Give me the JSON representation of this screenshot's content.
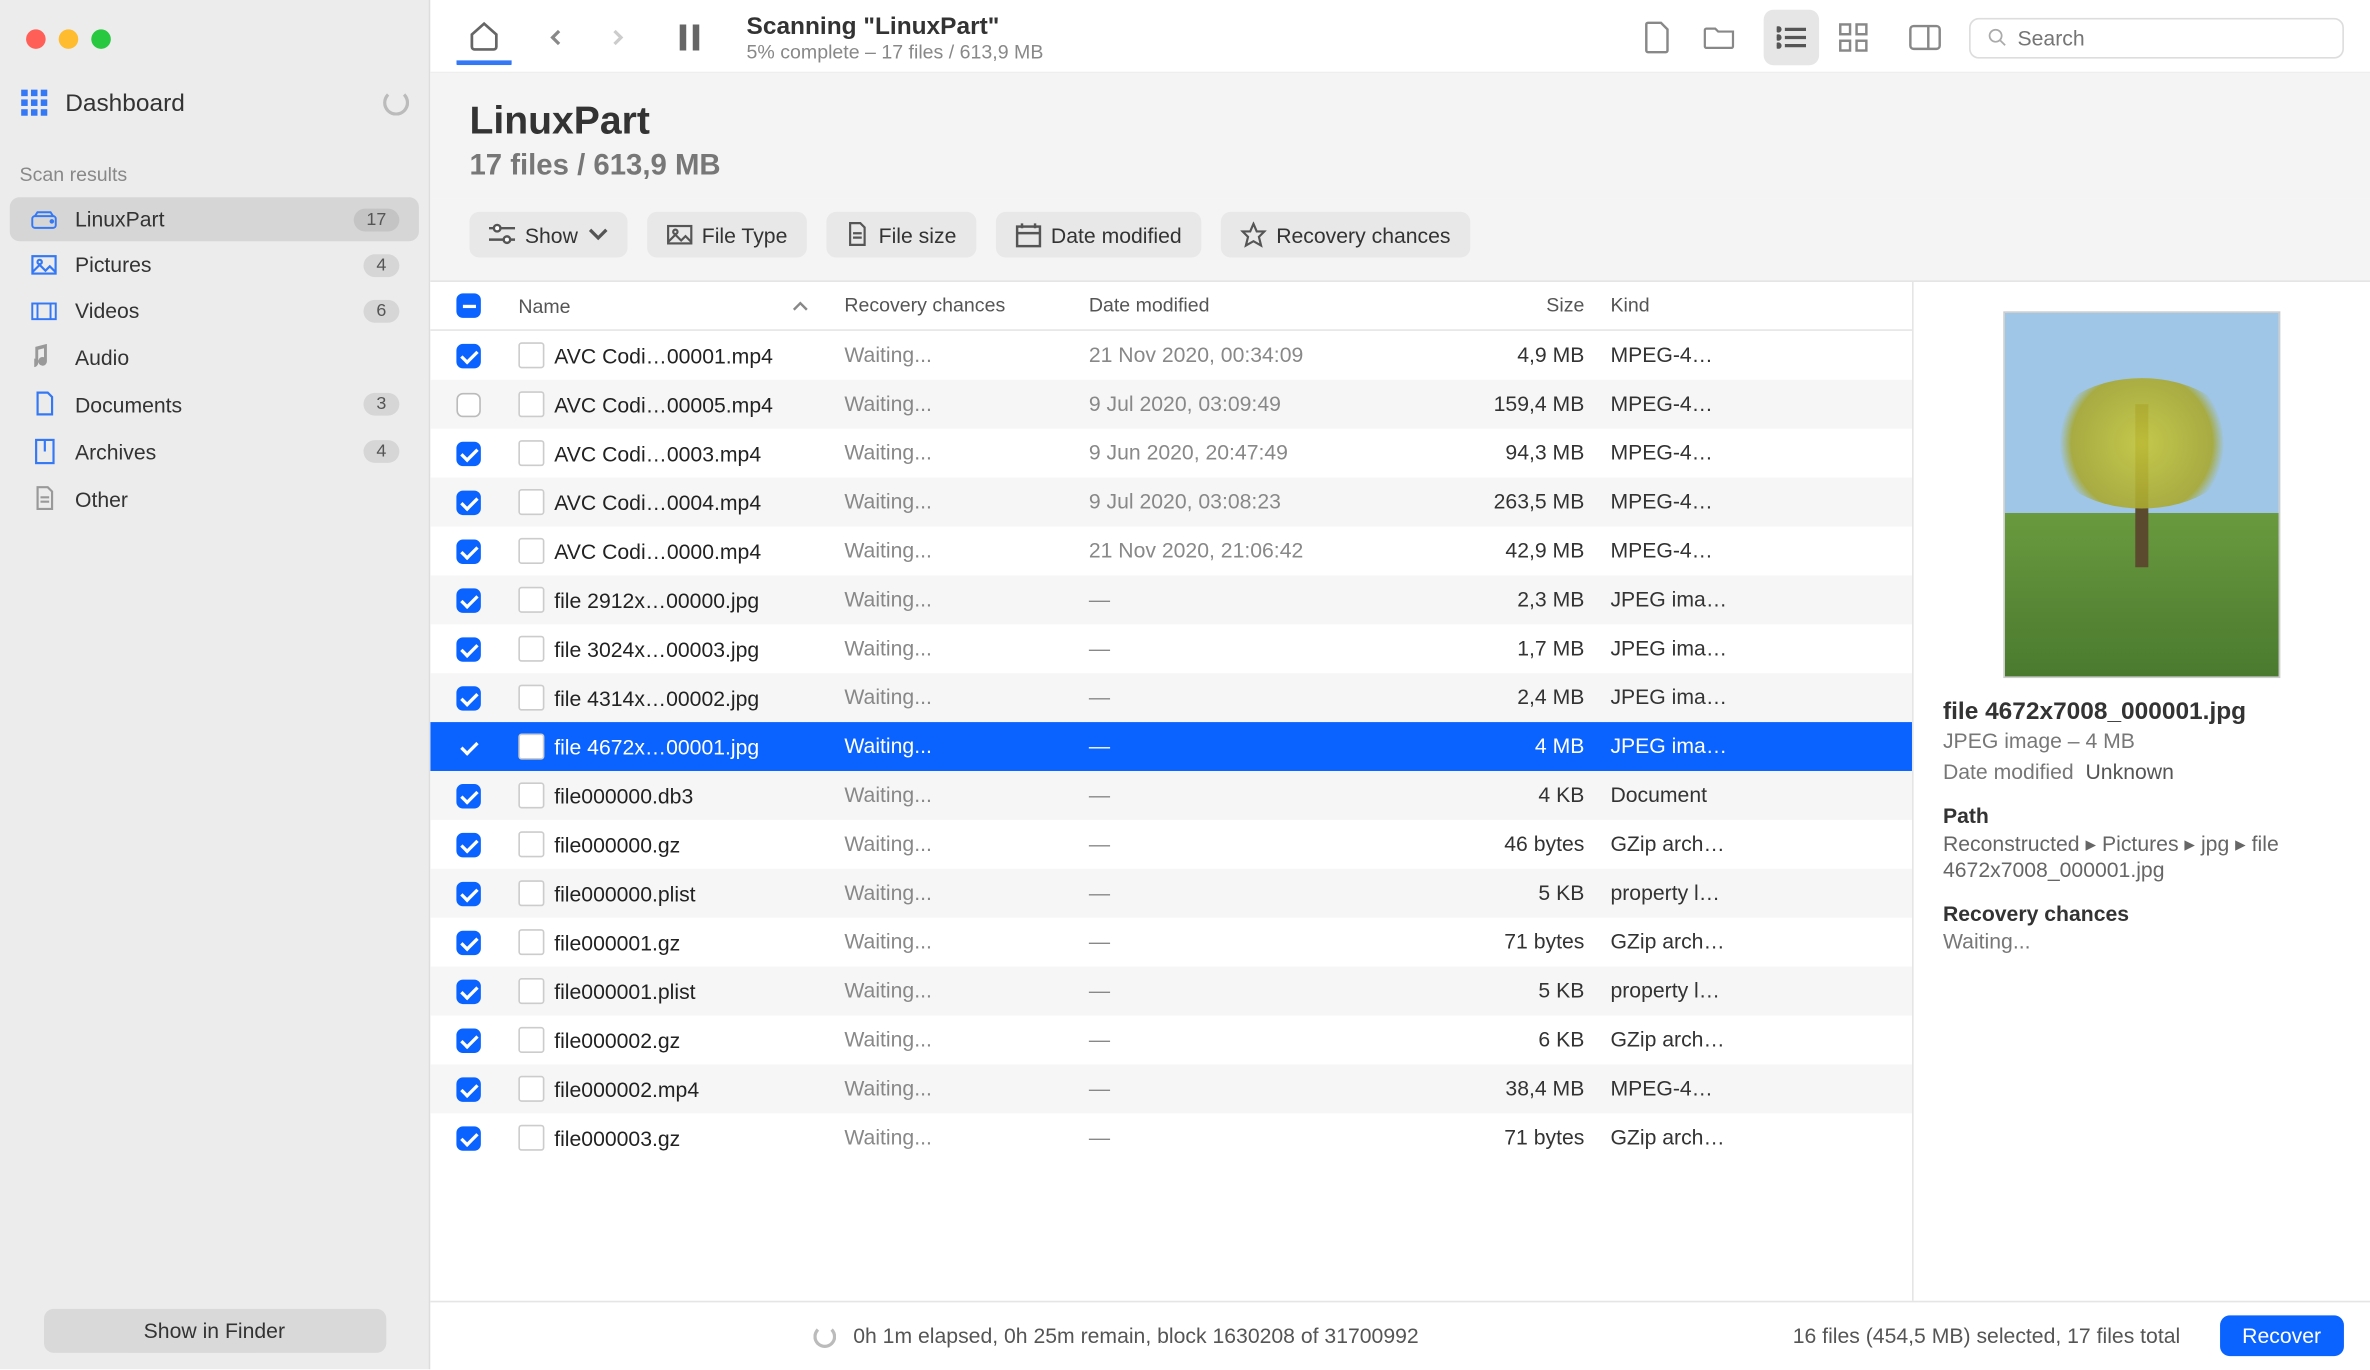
{
  "sidebar": {
    "dashboard": "Dashboard",
    "section": "Scan results",
    "items": [
      {
        "icon": "drive",
        "label": "LinuxPart",
        "badge": "17",
        "selected": true
      },
      {
        "icon": "image",
        "label": "Pictures",
        "badge": "4"
      },
      {
        "icon": "video",
        "label": "Videos",
        "badge": "6"
      },
      {
        "icon": "audio",
        "label": "Audio",
        "muted": true
      },
      {
        "icon": "doc",
        "label": "Documents",
        "badge": "3"
      },
      {
        "icon": "archive",
        "label": "Archives",
        "badge": "4"
      },
      {
        "icon": "other",
        "label": "Other",
        "muted": true
      }
    ],
    "finder_btn": "Show in Finder"
  },
  "toolbar": {
    "title": "Scanning \"LinuxPart\"",
    "subtitle": "5% complete – 17 files / 613,9 MB",
    "search_placeholder": "Search"
  },
  "header": {
    "title": "LinuxPart",
    "subtitle": "17 files / 613,9 MB"
  },
  "filters": {
    "show": "Show",
    "file_type": "File Type",
    "file_size": "File size",
    "date_modified": "Date modified",
    "recovery_chances": "Recovery chances"
  },
  "columns": {
    "name": "Name",
    "recovery": "Recovery chances",
    "date": "Date modified",
    "size": "Size",
    "kind": "Kind"
  },
  "rows": [
    {
      "checked": true,
      "name": "AVC Codi…00001.mp4",
      "recovery": "Waiting...",
      "date": "21 Nov 2020, 00:34:09",
      "size": "4,9 MB",
      "kind": "MPEG-4…"
    },
    {
      "checked": false,
      "name": "AVC Codi…00005.mp4",
      "recovery": "Waiting...",
      "date": "9 Jul 2020, 03:09:49",
      "size": "159,4 MB",
      "kind": "MPEG-4…"
    },
    {
      "checked": true,
      "name": "AVC Codi…0003.mp4",
      "recovery": "Waiting...",
      "date": "9 Jun 2020, 20:47:49",
      "size": "94,3 MB",
      "kind": "MPEG-4…"
    },
    {
      "checked": true,
      "name": "AVC Codi…0004.mp4",
      "recovery": "Waiting...",
      "date": "9 Jul 2020, 03:08:23",
      "size": "263,5 MB",
      "kind": "MPEG-4…"
    },
    {
      "checked": true,
      "name": "AVC Codi…0000.mp4",
      "recovery": "Waiting...",
      "date": "21 Nov 2020, 21:06:42",
      "size": "42,9 MB",
      "kind": "MPEG-4…"
    },
    {
      "checked": true,
      "name": "file 2912x…00000.jpg",
      "recovery": "Waiting...",
      "date": "—",
      "size": "2,3 MB",
      "kind": "JPEG ima…"
    },
    {
      "checked": true,
      "name": "file 3024x…00003.jpg",
      "recovery": "Waiting...",
      "date": "—",
      "size": "1,7 MB",
      "kind": "JPEG ima…"
    },
    {
      "checked": true,
      "name": "file 4314x…00002.jpg",
      "recovery": "Waiting...",
      "date": "—",
      "size": "2,4 MB",
      "kind": "JPEG ima…"
    },
    {
      "checked": true,
      "selected": true,
      "name": "file 4672x…00001.jpg",
      "recovery": "Waiting...",
      "date": "—",
      "size": "4 MB",
      "kind": "JPEG ima…"
    },
    {
      "checked": true,
      "name": "file000000.db3",
      "recovery": "Waiting...",
      "date": "—",
      "size": "4 KB",
      "kind": "Document"
    },
    {
      "checked": true,
      "name": "file000000.gz",
      "recovery": "Waiting...",
      "date": "—",
      "size": "46 bytes",
      "kind": "GZip arch…"
    },
    {
      "checked": true,
      "name": "file000000.plist",
      "recovery": "Waiting...",
      "date": "—",
      "size": "5 KB",
      "kind": "property l…"
    },
    {
      "checked": true,
      "name": "file000001.gz",
      "recovery": "Waiting...",
      "date": "—",
      "size": "71 bytes",
      "kind": "GZip arch…"
    },
    {
      "checked": true,
      "name": "file000001.plist",
      "recovery": "Waiting...",
      "date": "—",
      "size": "5 KB",
      "kind": "property l…"
    },
    {
      "checked": true,
      "name": "file000002.gz",
      "recovery": "Waiting...",
      "date": "—",
      "size": "6 KB",
      "kind": "GZip arch…"
    },
    {
      "checked": true,
      "name": "file000002.mp4",
      "recovery": "Waiting...",
      "date": "—",
      "size": "38,4 MB",
      "kind": "MPEG-4…"
    },
    {
      "checked": true,
      "name": "file000003.gz",
      "recovery": "Waiting...",
      "date": "—",
      "size": "71 bytes",
      "kind": "GZip arch…"
    }
  ],
  "details": {
    "filename": "file 4672x7008_000001.jpg",
    "kind_size": "JPEG image – 4 MB",
    "dm_label": "Date modified",
    "dm_value": "Unknown",
    "path_label": "Path",
    "path_value": "Reconstructed ▸ Pictures ▸ jpg ▸ file 4672x7008_000001.jpg",
    "rc_label": "Recovery chances",
    "rc_value": "Waiting..."
  },
  "status": {
    "elapsed": "0h 1m elapsed, 0h 25m remain, block 1630208 of 31700992",
    "selection": "16 files (454,5 MB) selected, 17 files total",
    "recover": "Recover"
  }
}
